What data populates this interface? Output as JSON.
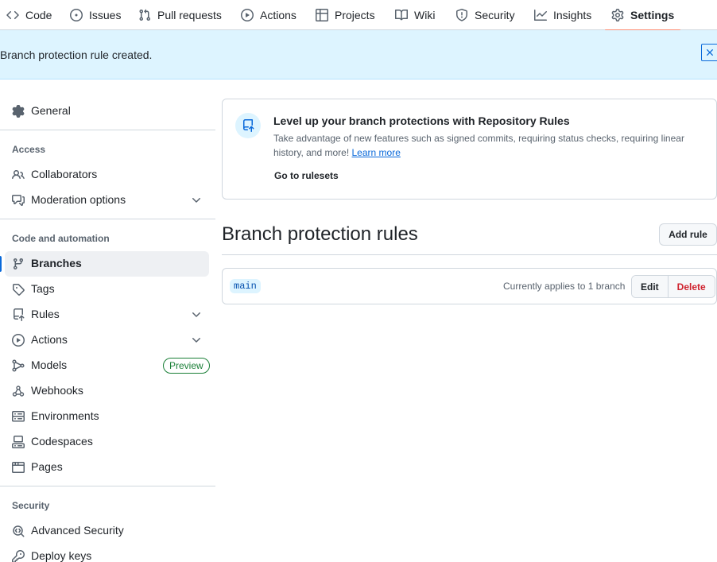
{
  "topnav": {
    "tabs": [
      {
        "label": "Code",
        "icon": "code-icon"
      },
      {
        "label": "Issues",
        "icon": "issue-opened-icon"
      },
      {
        "label": "Pull requests",
        "icon": "git-pull-request-icon"
      },
      {
        "label": "Actions",
        "icon": "play-icon"
      },
      {
        "label": "Projects",
        "icon": "table-icon"
      },
      {
        "label": "Wiki",
        "icon": "book-icon"
      },
      {
        "label": "Security",
        "icon": "shield-icon"
      },
      {
        "label": "Insights",
        "icon": "graph-icon"
      },
      {
        "label": "Settings",
        "icon": "gear-icon",
        "selected": true
      }
    ]
  },
  "flash": {
    "message": "Branch protection rule created."
  },
  "sidebar": {
    "general": "General",
    "access_heading": "Access",
    "collaborators": "Collaborators",
    "moderation": "Moderation options",
    "code_heading": "Code and automation",
    "branches": "Branches",
    "tags": "Tags",
    "rules": "Rules",
    "actions": "Actions",
    "models": "Models",
    "models_badge": "Preview",
    "webhooks": "Webhooks",
    "environments": "Environments",
    "codespaces": "Codespaces",
    "pages": "Pages",
    "security_heading": "Security",
    "advanced_security": "Advanced Security",
    "deploy_keys": "Deploy keys"
  },
  "banner": {
    "title": "Level up your branch protections with Repository Rules",
    "description": "Take advantage of new features such as signed commits, requiring status checks, requiring linear history, and more!",
    "learn_more": "Learn more",
    "rulesets_link": "Go to rulesets"
  },
  "main": {
    "title": "Branch protection rules",
    "add_rule": "Add rule",
    "rules": [
      {
        "branch": "main",
        "applies": "Currently applies to 1 branch",
        "edit": "Edit",
        "delete": "Delete"
      }
    ]
  },
  "colors": {
    "accent": "#0969da",
    "selected_underline": "#fd8c73",
    "danger": "#cf222e",
    "success": "#1a7f37",
    "flash_bg": "#ddf4ff"
  }
}
